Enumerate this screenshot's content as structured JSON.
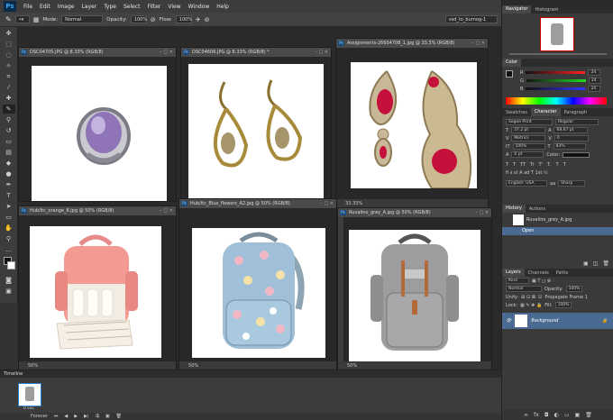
{
  "app": {
    "logo": "Ps"
  },
  "menu": [
    "File",
    "Edit",
    "Image",
    "Layer",
    "Type",
    "Select",
    "Filter",
    "View",
    "Window",
    "Help"
  ],
  "window_controls": [
    "–",
    "□",
    "✕"
  ],
  "options": {
    "mode_label": "Mode:",
    "mode_value": "Normal",
    "opacity_label": "Opacity:",
    "opacity_value": "100%",
    "flow_label": "Flow:",
    "flow_value": "100%",
    "workspace": "ssd_to_burnog-1"
  },
  "documents": [
    {
      "title": "DSC04705.JPG @ 8.33% (RGB/8)",
      "zoom": "",
      "img": "ring"
    },
    {
      "title": "DSC04606.JPG @ 8.33% (RGB/8) *",
      "zoom": "",
      "img": "earrings"
    },
    {
      "title": "Assignments-26604708_1.jpg @ 33.3% (RGB/8)",
      "zoom": "33.33%",
      "img": "pendant"
    },
    {
      "title": "Hub/itc_orange_8.jpg @ 50% (RGB/8)",
      "zoom": "50%",
      "img": "pink-bag"
    },
    {
      "title": "Hub/itc_Blue_flowers_A2.jpg @ 50% (RGB/8)",
      "zoom": "50%",
      "img": "blue-bag"
    },
    {
      "title": "Ruvalino_grey_A.jpg @ 50% (RGB/8)",
      "zoom": "50%",
      "img": "grey-bag"
    }
  ],
  "navigator": {
    "tabs": [
      "Navigator",
      "Histogram"
    ]
  },
  "color": {
    "tabs": [
      "Color"
    ],
    "r": "24",
    "g": "24",
    "b": "24",
    "r_label": "R",
    "g_label": "G",
    "b_label": "B"
  },
  "character": {
    "tabs": [
      "Swatches",
      "Character",
      "Paragraph"
    ],
    "font": "Segoe Print",
    "style": "Regular",
    "size": "37.2 pt",
    "leading": "68.67 pt",
    "kerning": "Metrics",
    "tracking": "0",
    "vscale": "100%",
    "hscale": "83%",
    "baseline": "0 pt",
    "color_label": "Color:",
    "language": "English: USA",
    "aa": "Sharp",
    "style_buttons": [
      "T",
      "T",
      "TT",
      "Tr",
      "T'",
      "T,",
      "T",
      "T"
    ]
  },
  "history": {
    "tabs": [
      "History",
      "Actions"
    ],
    "items": [
      "Ruvalino_grey_A.jpg",
      "Open"
    ]
  },
  "layers": {
    "tabs": [
      "Layers",
      "Channels",
      "Paths"
    ],
    "kind": "Kind",
    "blend": "Normal",
    "opacity_label": "Opacity:",
    "opacity": "100%",
    "unify_label": "Unify:",
    "propagate": "Propagate Frame 1",
    "lock_label": "Lock:",
    "fill_label": "Fill:",
    "fill": "100%",
    "layer_name": "Background"
  },
  "timeline": {
    "title": "Timeline",
    "frame_time": "0 sec.",
    "loop": "Forever"
  }
}
